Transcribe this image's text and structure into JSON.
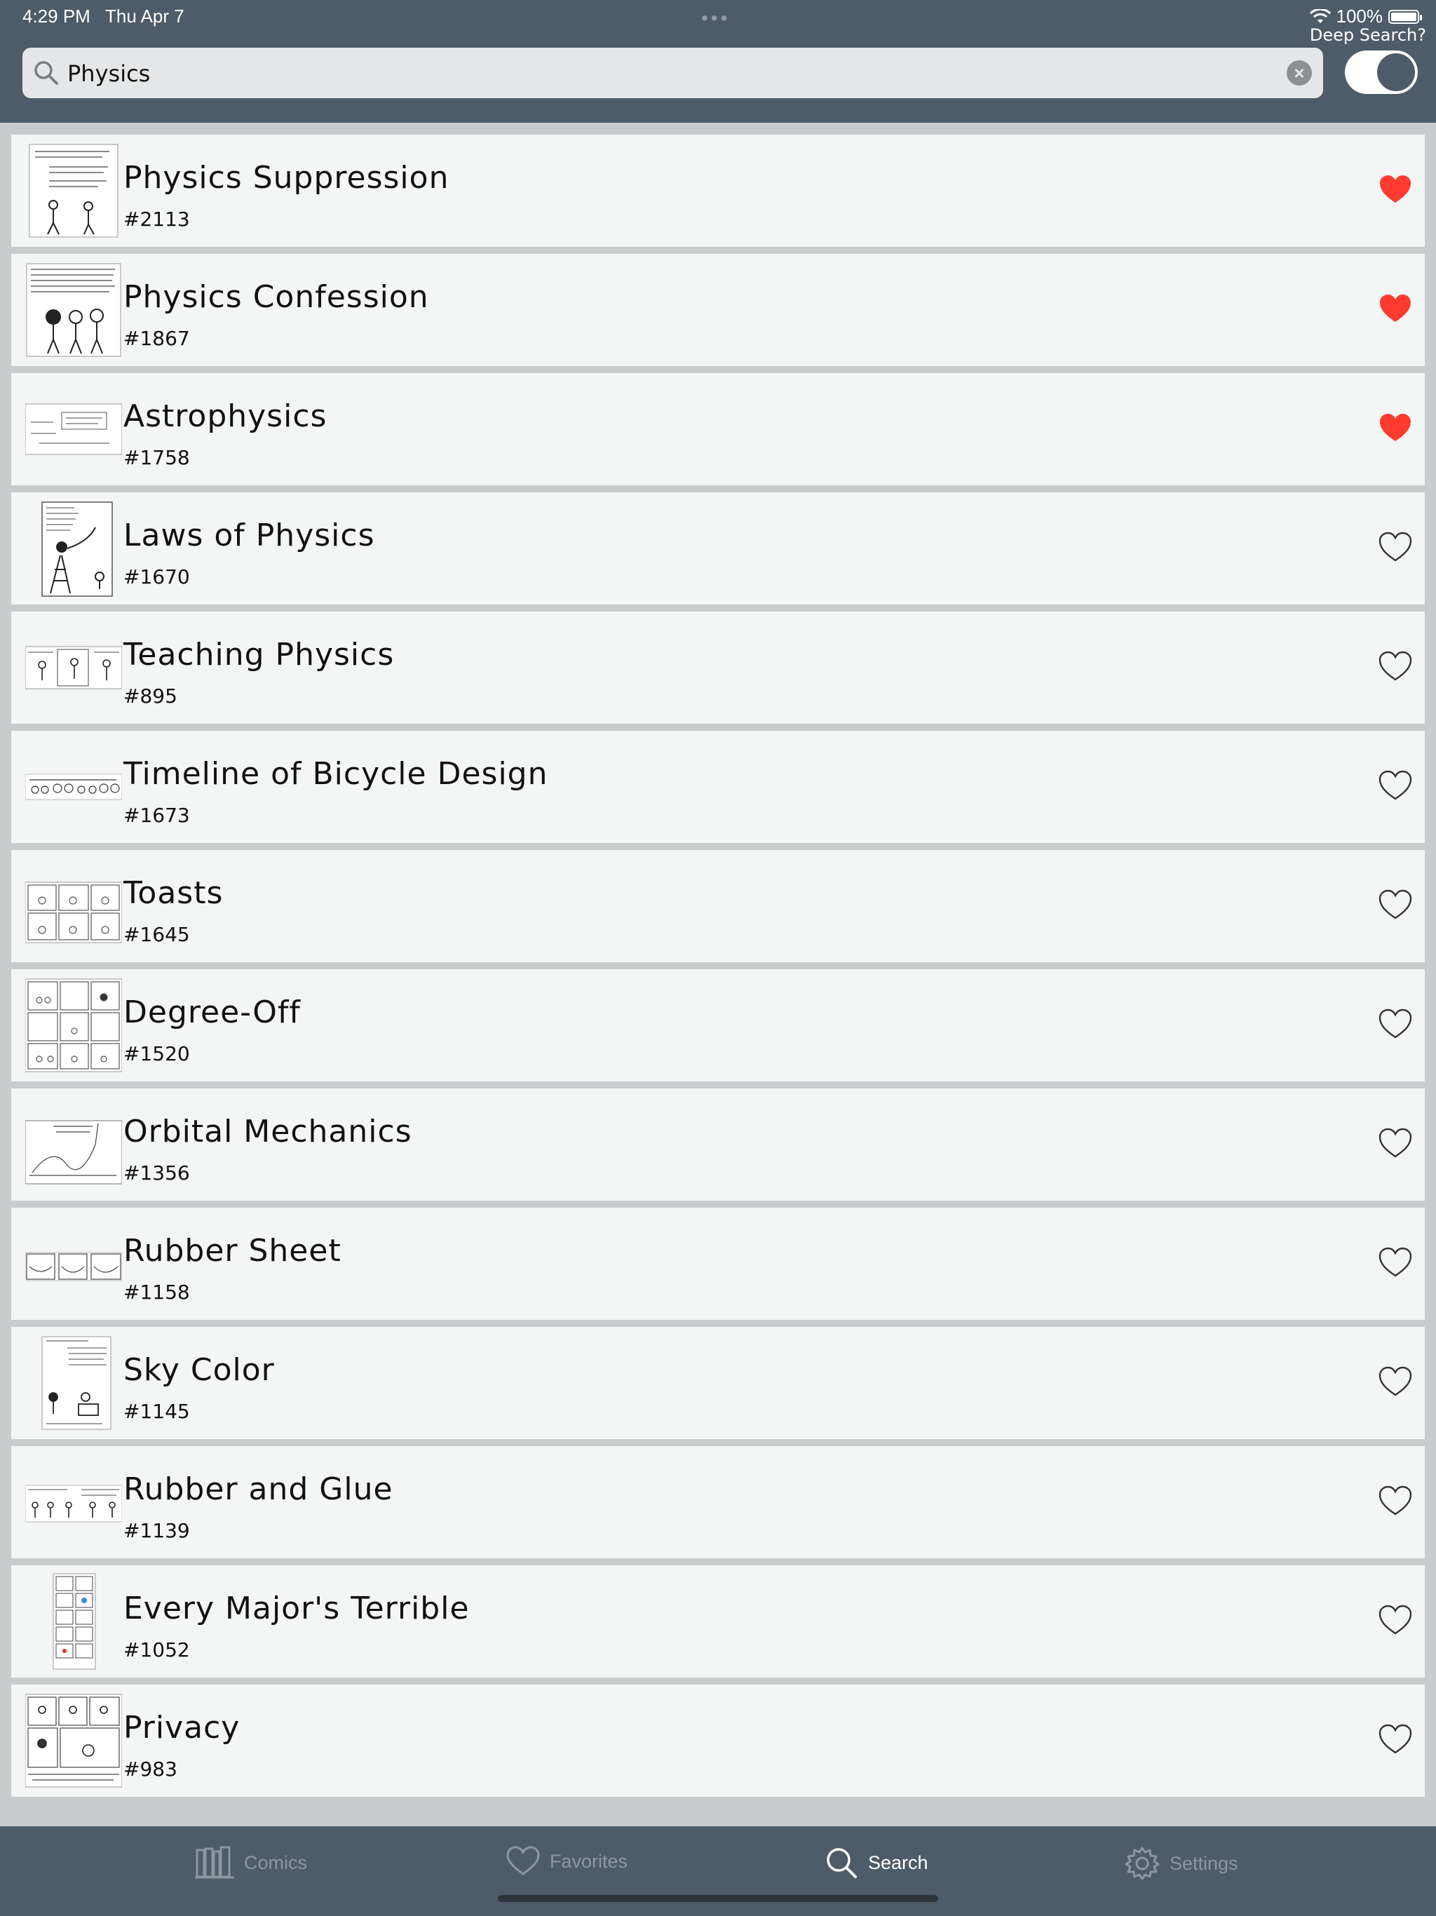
{
  "status": {
    "time": "4:29 PM",
    "date": "Thu Apr 7",
    "battery": "100%"
  },
  "search": {
    "value": "Physics",
    "deep_search_label": "Deep Search?",
    "deep_search_on": true
  },
  "results": [
    {
      "title": "Physics Suppression",
      "number": "#2113",
      "favorite": true
    },
    {
      "title": "Physics Confession",
      "number": "#1867",
      "favorite": true
    },
    {
      "title": "Astrophysics",
      "number": "#1758",
      "favorite": true
    },
    {
      "title": "Laws of Physics",
      "number": "#1670",
      "favorite": false
    },
    {
      "title": "Teaching Physics",
      "number": "#895",
      "favorite": false
    },
    {
      "title": "Timeline of Bicycle Design",
      "number": "#1673",
      "favorite": false
    },
    {
      "title": "Toasts",
      "number": "#1645",
      "favorite": false
    },
    {
      "title": "Degree-Off",
      "number": "#1520",
      "favorite": false
    },
    {
      "title": "Orbital Mechanics",
      "number": "#1356",
      "favorite": false
    },
    {
      "title": "Rubber Sheet",
      "number": "#1158",
      "favorite": false
    },
    {
      "title": "Sky Color",
      "number": "#1145",
      "favorite": false
    },
    {
      "title": "Rubber and Glue",
      "number": "#1139",
      "favorite": false
    },
    {
      "title": "Every Major's Terrible",
      "number": "#1052",
      "favorite": false
    },
    {
      "title": "Privacy",
      "number": "#983",
      "favorite": false
    }
  ],
  "tabs": [
    {
      "label": "Comics",
      "icon": "comics-icon",
      "active": false
    },
    {
      "label": "Favorites",
      "icon": "heart-icon",
      "active": false
    },
    {
      "label": "Search",
      "icon": "search-icon",
      "active": true
    },
    {
      "label": "Settings",
      "icon": "gear-icon",
      "active": false
    }
  ],
  "colors": {
    "bar": "#4d5c68",
    "favorite": "#ff3b30",
    "row": "#f4f5f5",
    "active_tab": "#ffffff",
    "inactive_tab": "#8b97a1"
  }
}
